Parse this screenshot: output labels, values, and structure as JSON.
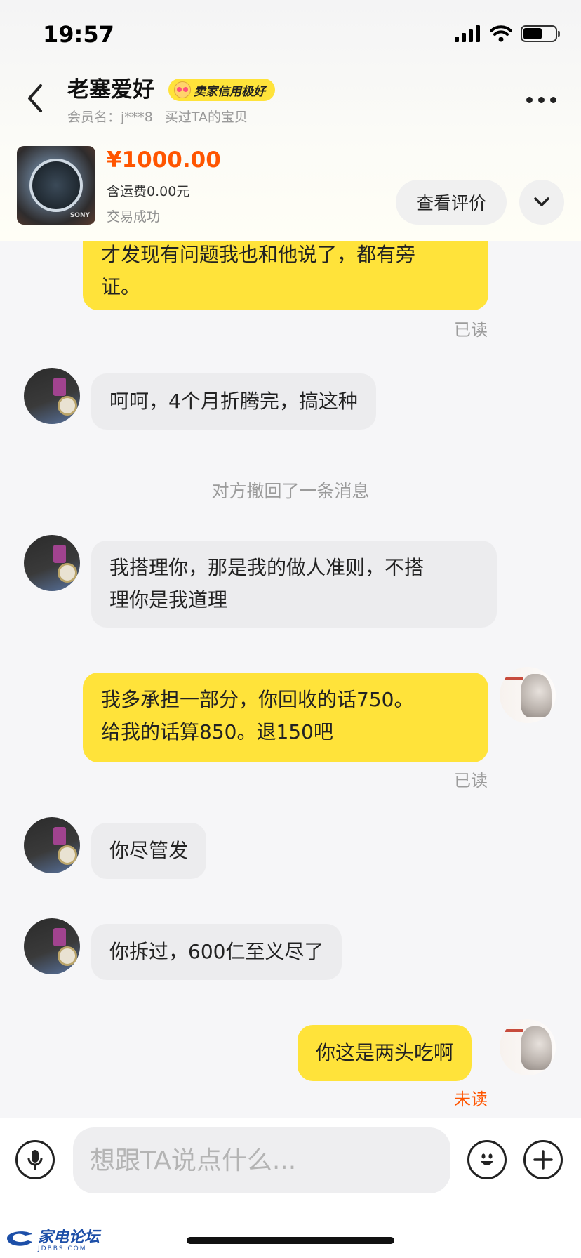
{
  "status_bar": {
    "time": "19:57"
  },
  "header": {
    "shop_name": "老塞爱好",
    "credit_badge": "卖家信用极好",
    "member_label": "会员名：j***8",
    "bought_link": "买过TA的宝贝"
  },
  "product": {
    "brand_mark": "SONY",
    "price": "¥1000.00",
    "shipping": "含运费0.00元",
    "status": "交易成功",
    "review_button": "查看评价"
  },
  "messages": [
    {
      "side": "mine",
      "text": "才发现有问题我也和他说了，都有旁证。",
      "line1": "才发现有问题我也和他说了，都有旁",
      "line2": "证。",
      "read": "已读"
    },
    {
      "side": "theirs",
      "text": "呵呵，4个月折腾完，搞这种"
    },
    {
      "side": "system",
      "text": "对方撤回了一条消息"
    },
    {
      "side": "theirs",
      "text": "我搭理你，那是我的做人准则，不搭理你是我道理",
      "line1": "我搭理你，那是我的做人准则，不搭",
      "line2": "理你是我道理"
    },
    {
      "side": "mine",
      "text": "我多承担一部分，你回收的话750。给我的话算850。退150吧",
      "line1": "我多承担一部分，你回收的话750。",
      "line2": "给我的话算850。退150吧",
      "read": "已读"
    },
    {
      "side": "theirs",
      "text": "你尽管发"
    },
    {
      "side": "theirs",
      "text": "你拆过，600仁至义尽了"
    },
    {
      "side": "mine",
      "text": "你这是两头吃啊",
      "read": "未读"
    }
  ],
  "input": {
    "placeholder": "想跟TA说点什么..."
  },
  "watermark": {
    "text": "家电论坛",
    "sub": "JDBBS.COM"
  },
  "colors": {
    "accent_yellow": "#ffe33a",
    "price_orange": "#ff5500",
    "unread_orange": "#ff5500"
  }
}
